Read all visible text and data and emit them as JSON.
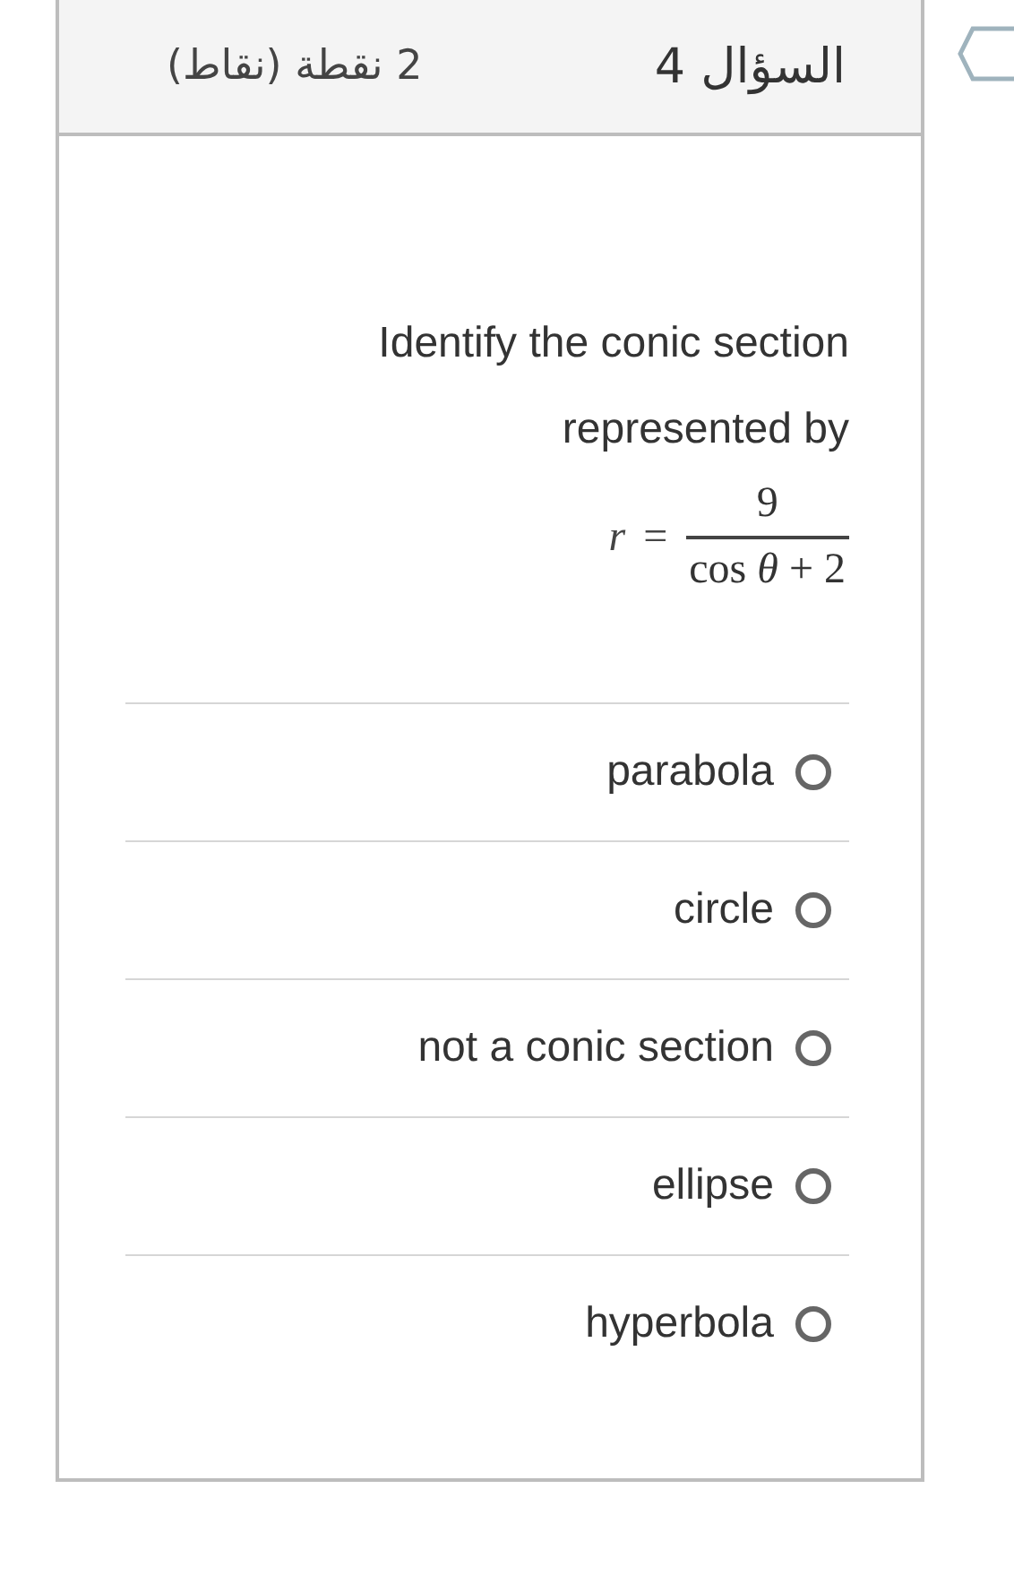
{
  "header": {
    "title": "السؤال 4",
    "points": "2 نقطة (نقاط)"
  },
  "question": {
    "text": "Identify the conic section represented by",
    "formula": {
      "lhs": "r",
      "relation": "=",
      "numerator": "9",
      "denominator": "cos *θ* + 2"
    }
  },
  "options": [
    {
      "label": "parabola",
      "selected": false
    },
    {
      "label": "circle",
      "selected": false
    },
    {
      "label": "not a conic section",
      "selected": false
    },
    {
      "label": "ellipse",
      "selected": false
    },
    {
      "label": "hyperbola",
      "selected": false
    }
  ]
}
